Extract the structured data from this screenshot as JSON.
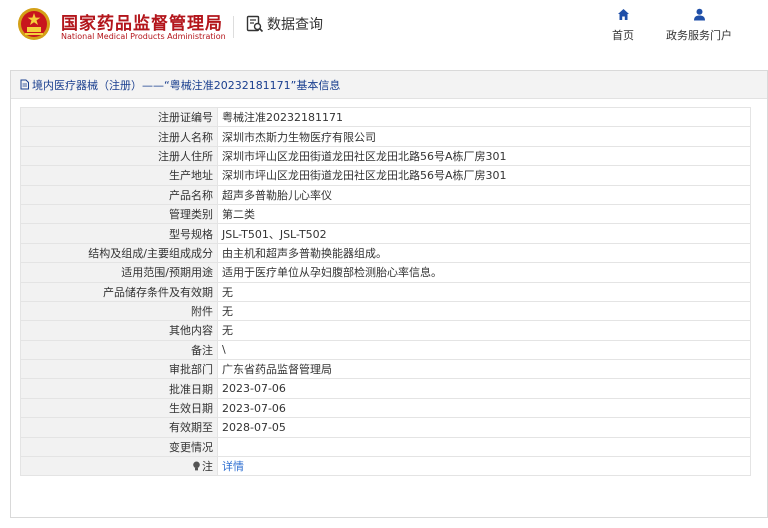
{
  "header": {
    "brand_cn": "国家药品监督管理局",
    "brand_en": "National Medical Products Administration",
    "query_label": "数据查询",
    "nav": [
      {
        "label": "首页",
        "icon": "home-icon"
      },
      {
        "label": "政务服务门户",
        "icon": "user-icon"
      }
    ]
  },
  "panel": {
    "title": "境内医疗器械（注册）——“粤械注准20232181171”基本信息"
  },
  "fields": [
    {
      "label": "注册证编号",
      "value": "粤械注准20232181171"
    },
    {
      "label": "注册人名称",
      "value": "深圳市杰斯力生物医疗有限公司"
    },
    {
      "label": "注册人住所",
      "value": "深圳市坪山区龙田街道龙田社区龙田北路56号A栋厂房301"
    },
    {
      "label": "生产地址",
      "value": "深圳市坪山区龙田街道龙田社区龙田北路56号A栋厂房301"
    },
    {
      "label": "产品名称",
      "value": "超声多普勒胎儿心率仪"
    },
    {
      "label": "管理类别",
      "value": "第二类"
    },
    {
      "label": "型号规格",
      "value": "JSL-T501、JSL-T502"
    },
    {
      "label": "结构及组成/主要组成成分",
      "value": "由主机和超声多普勒换能器组成。"
    },
    {
      "label": "适用范围/预期用途",
      "value": "适用于医疗单位从孕妇腹部检测胎心率信息。"
    },
    {
      "label": "产品储存条件及有效期",
      "value": "无"
    },
    {
      "label": "附件",
      "value": "无"
    },
    {
      "label": "其他内容",
      "value": "无"
    },
    {
      "label": "备注",
      "value": "\\"
    },
    {
      "label": "审批部门",
      "value": "广东省药品监督管理局"
    },
    {
      "label": "批准日期",
      "value": "2023-07-06"
    },
    {
      "label": "生效日期",
      "value": "2023-07-06"
    },
    {
      "label": "有效期至",
      "value": "2028-07-05"
    },
    {
      "label": "变更情况",
      "value": ""
    }
  ],
  "note": {
    "label": "注",
    "icon": "lightbulb-icon",
    "link": "详情"
  },
  "colors": {
    "brand": "#b3151b",
    "link": "#2f6fd1",
    "title": "#1a3f8f",
    "label_bg": "#f2f2f2"
  }
}
